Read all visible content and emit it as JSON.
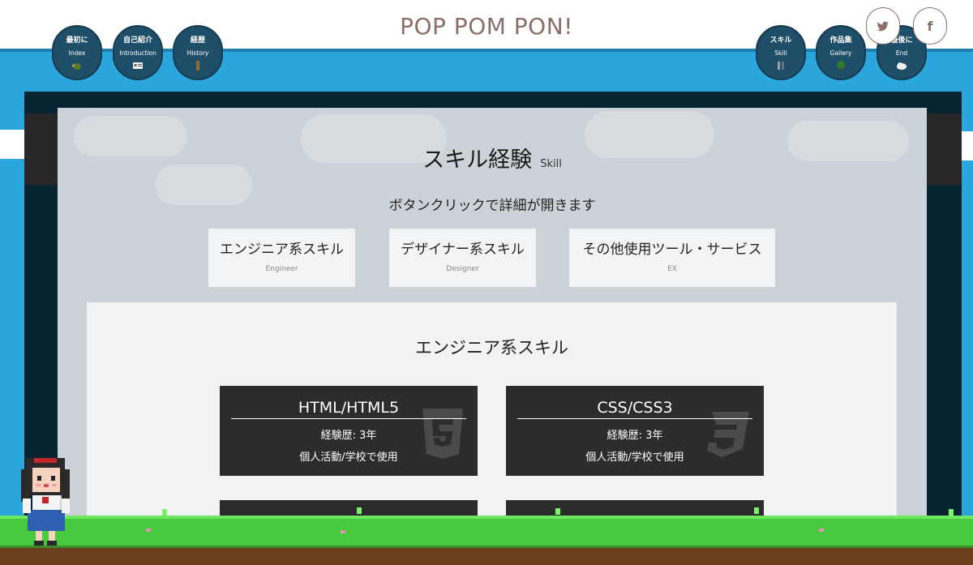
{
  "site": {
    "title": "POP POM PON!"
  },
  "nav_left": [
    {
      "jp": "最初に",
      "en": "Index"
    },
    {
      "jp": "自己紹介",
      "en": "Introduction"
    },
    {
      "jp": "経歴",
      "en": "History"
    }
  ],
  "nav_right": [
    {
      "jp": "スキル",
      "en": "Skill"
    },
    {
      "jp": "作品集",
      "en": "Gallery"
    },
    {
      "jp": "最後に",
      "en": "End"
    }
  ],
  "social": {
    "twitter": "twitter-icon",
    "facebook": "f"
  },
  "section": {
    "title": "スキル経験",
    "subtitle": "Skill",
    "hint": "ボタンクリックで詳細が開きます"
  },
  "tabs": [
    {
      "label": "エンジニア系スキル",
      "sub": "Engineer"
    },
    {
      "label": "デザイナー系スキル",
      "sub": "Designer"
    },
    {
      "label": "その他使用ツール・サービス",
      "sub": "EX"
    }
  ],
  "panel": {
    "title": "エンジニア系スキル",
    "cards": [
      {
        "title": "HTML/HTML5",
        "experience": "経験歴: 3年",
        "usage": "個人活動/学校で使用",
        "icon": "html5-icon"
      },
      {
        "title": "CSS/CSS3",
        "experience": "経験歴: 3年",
        "usage": "個人活動/学校で使用",
        "icon": "css3-icon"
      }
    ]
  },
  "colors": {
    "sky": "#2aa6dd",
    "frame": "#082433",
    "card": "#2c2c2c",
    "title": "#8a6f68",
    "grass": "#49c93d"
  }
}
